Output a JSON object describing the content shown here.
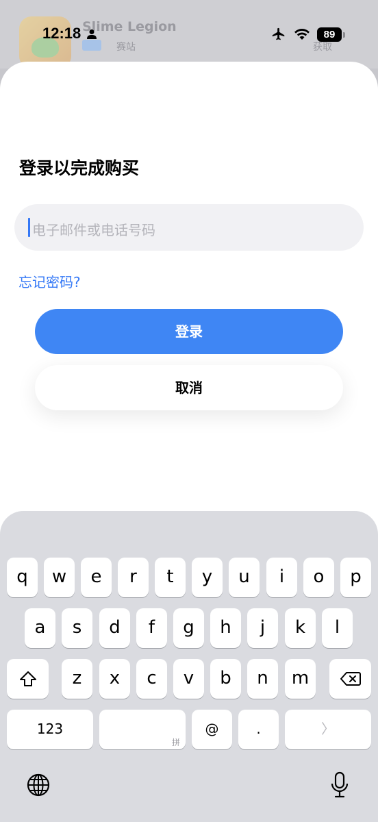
{
  "status_bar": {
    "time": "12:18",
    "battery": "89"
  },
  "background_app": {
    "title": "Slime Legion",
    "subtitle": "赛站",
    "action": "获取"
  },
  "sheet": {
    "title": "登录以完成购买",
    "input_placeholder": "电子邮件或电话号码",
    "forgot_label": "忘记密码?",
    "login_label": "登录",
    "cancel_label": "取消",
    "accent_color": "#3f86f4"
  },
  "keyboard": {
    "row1": [
      "q",
      "w",
      "e",
      "r",
      "t",
      "y",
      "u",
      "i",
      "o",
      "p"
    ],
    "row2": [
      "a",
      "s",
      "d",
      "f",
      "g",
      "h",
      "j",
      "k",
      "l"
    ],
    "row3": [
      "z",
      "x",
      "c",
      "v",
      "b",
      "n",
      "m"
    ],
    "numbers_label": "123",
    "space_sub_label": "拼",
    "at_label": "@",
    "dot_label": ".",
    "return_label": "〉"
  }
}
